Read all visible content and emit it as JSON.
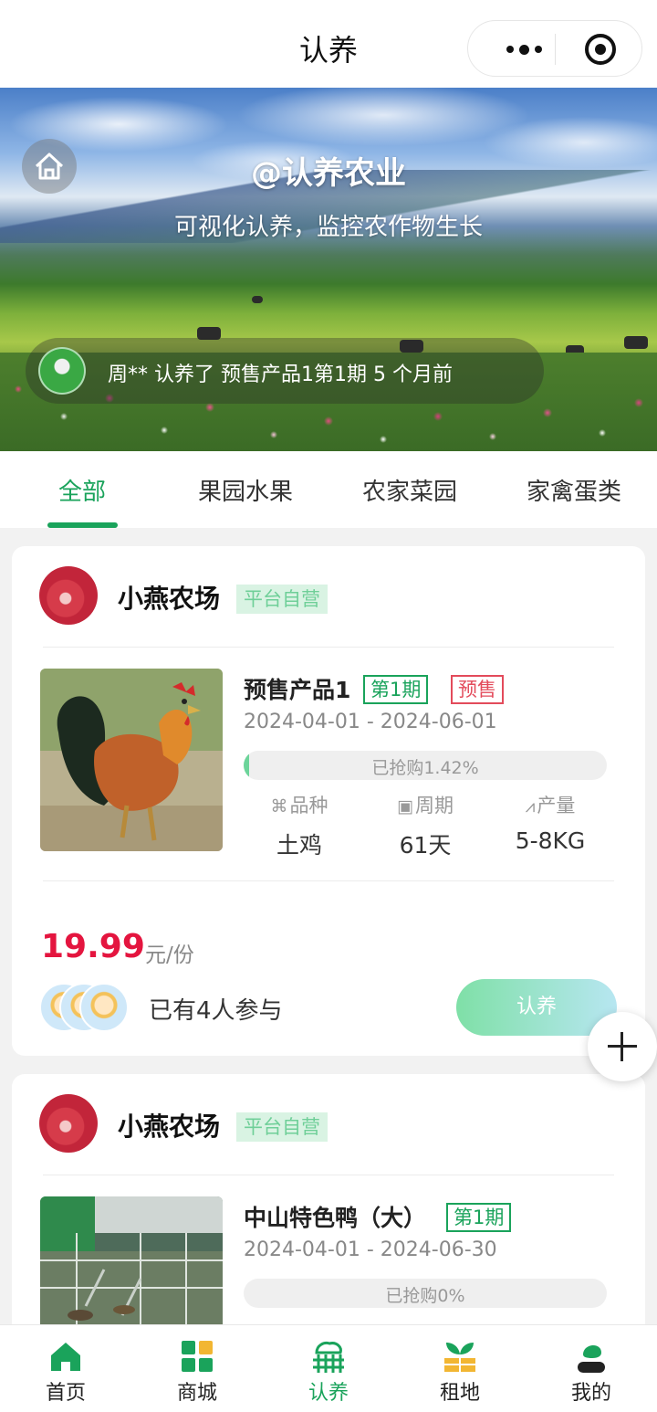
{
  "header": {
    "title": "认养"
  },
  "hero": {
    "brand": "@认养农业",
    "slogan": "可视化认养，监控农作物生长",
    "ticker": "周** 认养了 预售产品1第1期 5 个月前"
  },
  "tabs": [
    {
      "label": "全部",
      "active": true
    },
    {
      "label": "果园水果",
      "active": false
    },
    {
      "label": "农家菜园",
      "active": false
    },
    {
      "label": "家禽蛋类",
      "active": false
    }
  ],
  "cards": [
    {
      "farm": "小燕农场",
      "badge": "平台自营",
      "product": "预售产品1",
      "period_tag": "第1期",
      "presale_tag": "预售",
      "dates": "2024-04-01 - 2024-06-01",
      "progress_text": "已抢购1.42%",
      "progress_percent": 1.42,
      "specs": [
        {
          "key": "品种",
          "icon": "variety-icon",
          "value": "土鸡"
        },
        {
          "key": "周期",
          "icon": "calendar-icon",
          "value": "61天"
        },
        {
          "key": "产量",
          "icon": "chart-icon",
          "value": "5-8KG"
        }
      ],
      "price": "19.99",
      "unit": "元/份",
      "participants": "已有4人参与",
      "button": "认养",
      "image": "rooster-photo"
    },
    {
      "farm": "小燕农场",
      "badge": "平台自营",
      "product": "中山特色鸭（大）",
      "period_tag": "第1期",
      "dates": "2024-04-01 - 2024-06-30",
      "progress_text": "已抢购0%",
      "progress_percent": 0,
      "image": "duck-pond-photo"
    }
  ],
  "bottom_nav": [
    {
      "label": "首页",
      "icon": "home-icon",
      "active": false
    },
    {
      "label": "商城",
      "icon": "shop-icon",
      "active": false
    },
    {
      "label": "认养",
      "icon": "adopt-icon",
      "active": true
    },
    {
      "label": "租地",
      "icon": "rent-land-icon",
      "active": false
    },
    {
      "label": "我的",
      "icon": "profile-icon",
      "active": false
    }
  ],
  "colors": {
    "accent": "#1aa35b",
    "price": "#e4153f",
    "presale": "#e34b5b"
  }
}
